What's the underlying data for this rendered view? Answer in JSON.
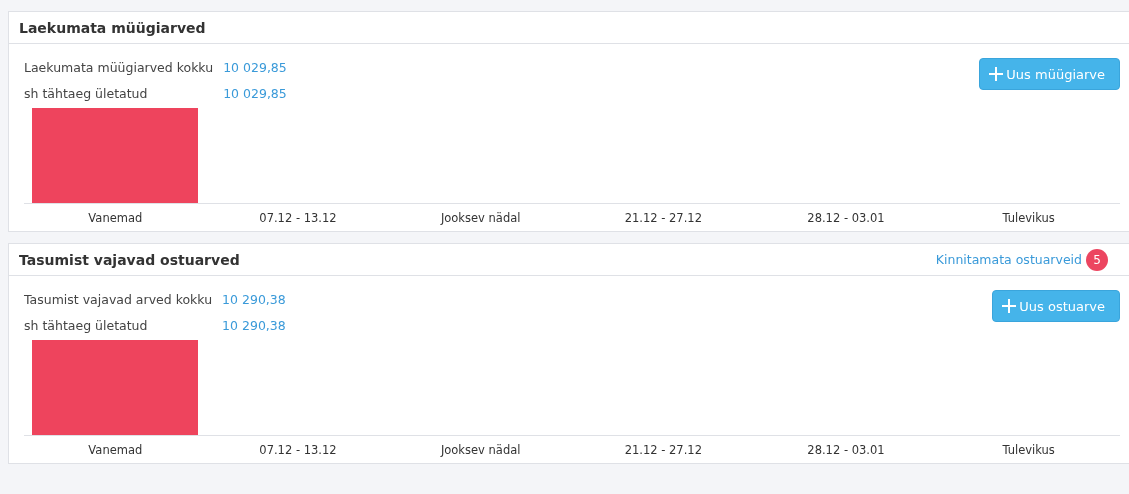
{
  "panels": [
    {
      "title": "Laekumata müügiarved",
      "summary": [
        {
          "label": "Laekumata müügiarved kokku",
          "value": "10 029,85"
        },
        {
          "label": "sh tähtaeg ületatud",
          "value": "10 029,85"
        }
      ],
      "button": {
        "label": "Uus müügiarve"
      },
      "columns": [
        {
          "label": "Vanemad",
          "kind": "bar"
        },
        {
          "label": "07.12 - 13.12",
          "kind": "empty"
        },
        {
          "label": "Jooksev nädal",
          "kind": "empty"
        },
        {
          "label": "21.12 - 27.12",
          "kind": "empty"
        },
        {
          "label": "28.12 - 03.01",
          "kind": "empty"
        },
        {
          "label": "Tulevikus",
          "kind": "empty"
        }
      ]
    },
    {
      "title": "Tasumist vajavad ostuarved",
      "link": {
        "label": "Kinnitamata ostuarveid",
        "count": "5"
      },
      "summary": [
        {
          "label": "Tasumist vajavad arved kokku",
          "value": "10 290,38"
        },
        {
          "label": "sh tähtaeg ületatud",
          "value": "10 290,38"
        }
      ],
      "button": {
        "label": "Uus ostuarve"
      },
      "columns": [
        {
          "label": "Vanemad",
          "kind": "bar"
        },
        {
          "label": "07.12 - 13.12",
          "kind": "empty"
        },
        {
          "label": "Jooksev nädal",
          "kind": "empty"
        },
        {
          "label": "21.12 - 27.12",
          "kind": "empty"
        },
        {
          "label": "28.12 - 03.01",
          "kind": "empty"
        },
        {
          "label": "Tulevikus",
          "kind": "empty"
        }
      ]
    }
  ]
}
